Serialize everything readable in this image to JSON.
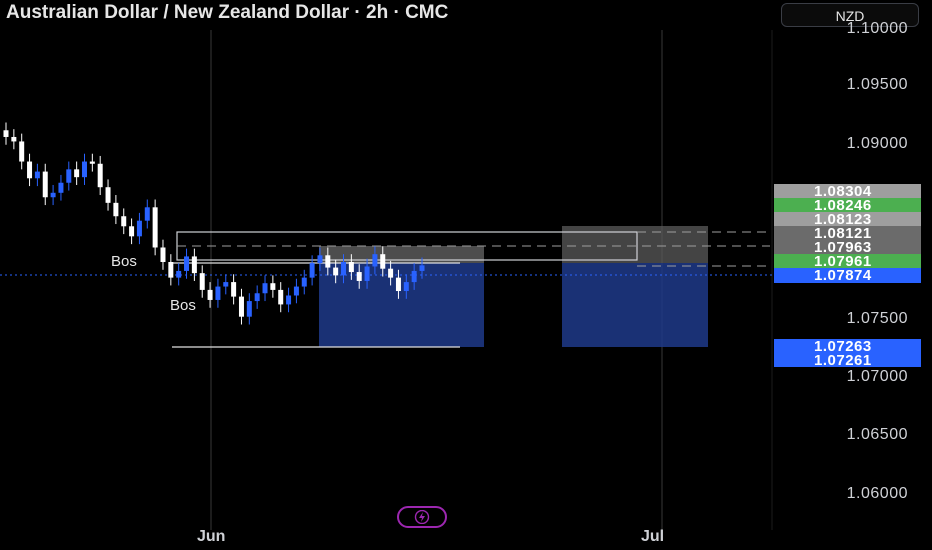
{
  "header": {
    "title": "Australian Dollar / New Zealand Dollar · 2h · CMC",
    "currency": "NZD"
  },
  "price_axis": {
    "labels": [
      "1.10000",
      "1.09500",
      "1.09000",
      "1.07500",
      "1.07000",
      "1.06500",
      "1.06000"
    ]
  },
  "price_tags": [
    {
      "value": "1.08304",
      "color": "#9e9e9e"
    },
    {
      "value": "1.08246",
      "color": "#4caf50"
    },
    {
      "value": "1.08123",
      "color": "#9e9e9e"
    },
    {
      "value": "1.08121",
      "color": "#6b6b6b"
    },
    {
      "value": "1.07963",
      "color": "#6b6b6b"
    },
    {
      "value": "1.07961",
      "color": "#4caf50"
    },
    {
      "value": "1.07874",
      "color": "#2962ff"
    },
    {
      "value": "1.07263",
      "color": "#2962ff"
    },
    {
      "value": "1.07261",
      "color": "#2962ff"
    }
  ],
  "time_axis": {
    "labels": [
      "Jun",
      "Jul"
    ]
  },
  "annotations": {
    "bos_upper": "Bos",
    "bos_lower": "Bos"
  },
  "colors": {
    "candle_up": "#2962ff",
    "candle_down": "#ffffff",
    "box_fill": "#1e3a8a"
  },
  "icons": {
    "replay": "lightning-bolt-icon"
  },
  "chart_data": {
    "type": "candlestick",
    "symbol": "AUD/NZD",
    "interval": "2h",
    "ylim": [
      1.0575,
      1.1005
    ],
    "closes": [
      1.0902,
      1.0898,
      1.088,
      1.0865,
      1.0871,
      1.0848,
      1.0852,
      1.0861,
      1.0873,
      1.0866,
      1.088,
      1.0878,
      1.0857,
      1.0843,
      1.0831,
      1.0822,
      1.0813,
      1.0827,
      1.0839,
      1.0803,
      1.079,
      1.0776,
      1.0782,
      1.0795,
      1.078,
      1.0765,
      1.0756,
      1.0768,
      1.0772,
      1.0759,
      1.0741,
      1.0755,
      1.0762,
      1.0771,
      1.0765,
      1.0752,
      1.076,
      1.0768,
      1.0776,
      1.0789,
      1.0796,
      1.0785,
      1.0778,
      1.079,
      1.0781,
      1.0773,
      1.0786,
      1.0797,
      1.0784,
      1.0776,
      1.0764,
      1.0772,
      1.0782,
      1.0787
    ]
  }
}
